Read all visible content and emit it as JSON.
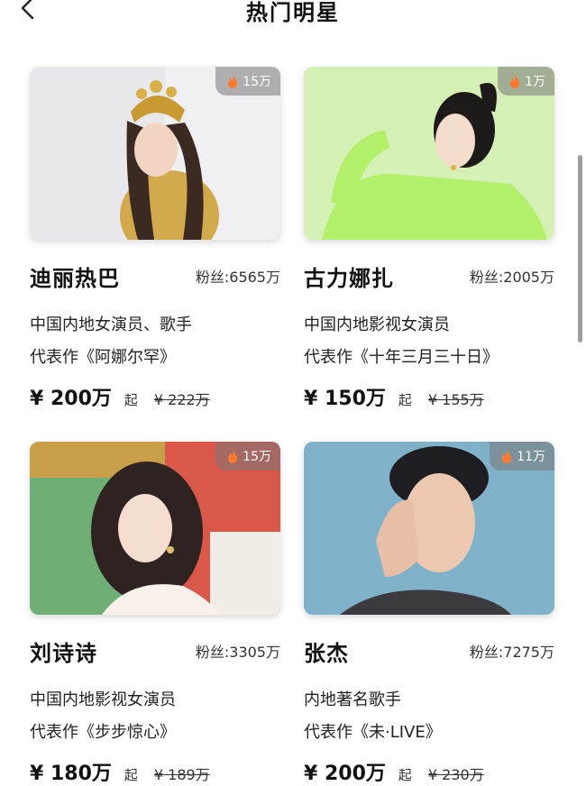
{
  "header": {
    "title": "热门明星"
  },
  "stars": [
    {
      "name": "迪丽热巴",
      "fans": "粉丝:6565万",
      "heat": "15万",
      "desc": "中国内地女演员、歌手",
      "works": "代表作《阿娜尔罕》",
      "price": "¥ 200万",
      "from": "起",
      "old_price": "¥ 222万"
    },
    {
      "name": "古力娜扎",
      "fans": "粉丝:2005万",
      "heat": "1万",
      "desc": "中国内地影视女演员",
      "works": "代表作《十年三月三十日》",
      "price": "¥ 150万",
      "from": "起",
      "old_price": "¥ 155万"
    },
    {
      "name": "刘诗诗",
      "fans": "粉丝:3305万",
      "heat": "15万",
      "desc": "中国内地影视女演员",
      "works": "代表作《步步惊心》",
      "price": "¥ 180万",
      "from": "起",
      "old_price": "¥ 189万"
    },
    {
      "name": "张杰",
      "fans": "粉丝:7275万",
      "heat": "11万",
      "desc": "内地著名歌手",
      "works": "代表作《未·LIVE》",
      "price": "¥ 200万",
      "from": "起",
      "old_price": "¥ 230万"
    }
  ],
  "icons": {
    "back": "chevron-left-icon",
    "heat": "flame-icon"
  },
  "colors": {
    "flame": "#ff7a2e",
    "badge_bg": "#8a8a8a"
  }
}
